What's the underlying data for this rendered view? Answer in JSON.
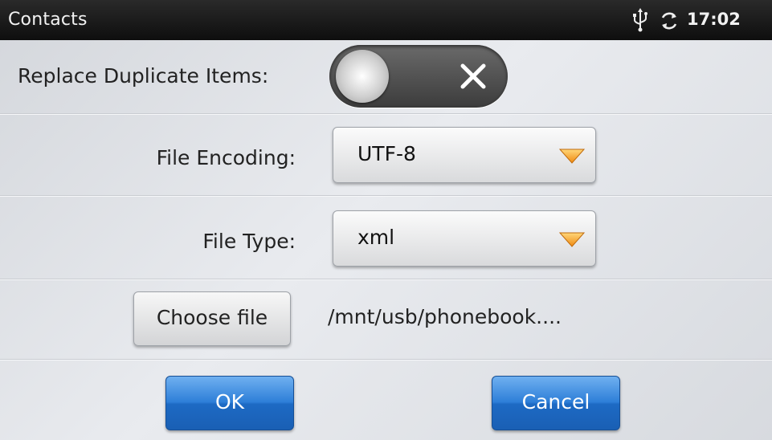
{
  "statusbar": {
    "app_title": "Contacts",
    "time": "17:02",
    "icons": [
      "usb-icon",
      "sync-icon"
    ]
  },
  "form": {
    "replace_label": "Replace Duplicate Items:",
    "replace_toggle_state": "off",
    "encoding_label": "File Encoding:",
    "encoding_value": "UTF-8",
    "type_label": "File Type:",
    "type_value": "xml",
    "choose_file_label": "Choose file",
    "file_path": "/mnt/usb/phonebook...."
  },
  "buttons": {
    "ok_label": "OK",
    "cancel_label": "Cancel"
  },
  "colors": {
    "accent_blue": "#2e7fd8",
    "dropdown_arrow": "#f5a623",
    "statusbar_bg": "#1a1a1a"
  }
}
